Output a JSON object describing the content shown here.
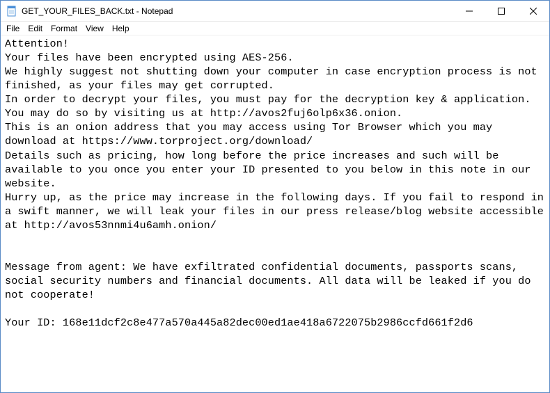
{
  "window": {
    "title": "GET_YOUR_FILES_BACK.txt - Notepad"
  },
  "menu": {
    "file": "File",
    "edit": "Edit",
    "format": "Format",
    "view": "View",
    "help": "Help"
  },
  "document": {
    "text": "Attention!\nYour files have been encrypted using AES-256.\nWe highly suggest not shutting down your computer in case encryption process is not finished, as your files may get corrupted.\nIn order to decrypt your files, you must pay for the decryption key & application.\nYou may do so by visiting us at http://avos2fuj6olp6x36.onion.\nThis is an onion address that you may access using Tor Browser which you may download at https://www.torproject.org/download/\nDetails such as pricing, how long before the price increases and such will be available to you once you enter your ID presented to you below in this note in our website.\nHurry up, as the price may increase in the following days. If you fail to respond in a swift manner, we will leak your files in our press release/blog website accessible at http://avos53nnmi4u6amh.onion/\n\n\nMessage from agent: We have exfiltrated confidential documents, passports scans, social security numbers and financial documents. All data will be leaked if you do not cooperate!\n\nYour ID: 168e11dcf2c8e477a570a445a82dec00ed1ae418a6722075b2986ccfd661f2d6"
  }
}
